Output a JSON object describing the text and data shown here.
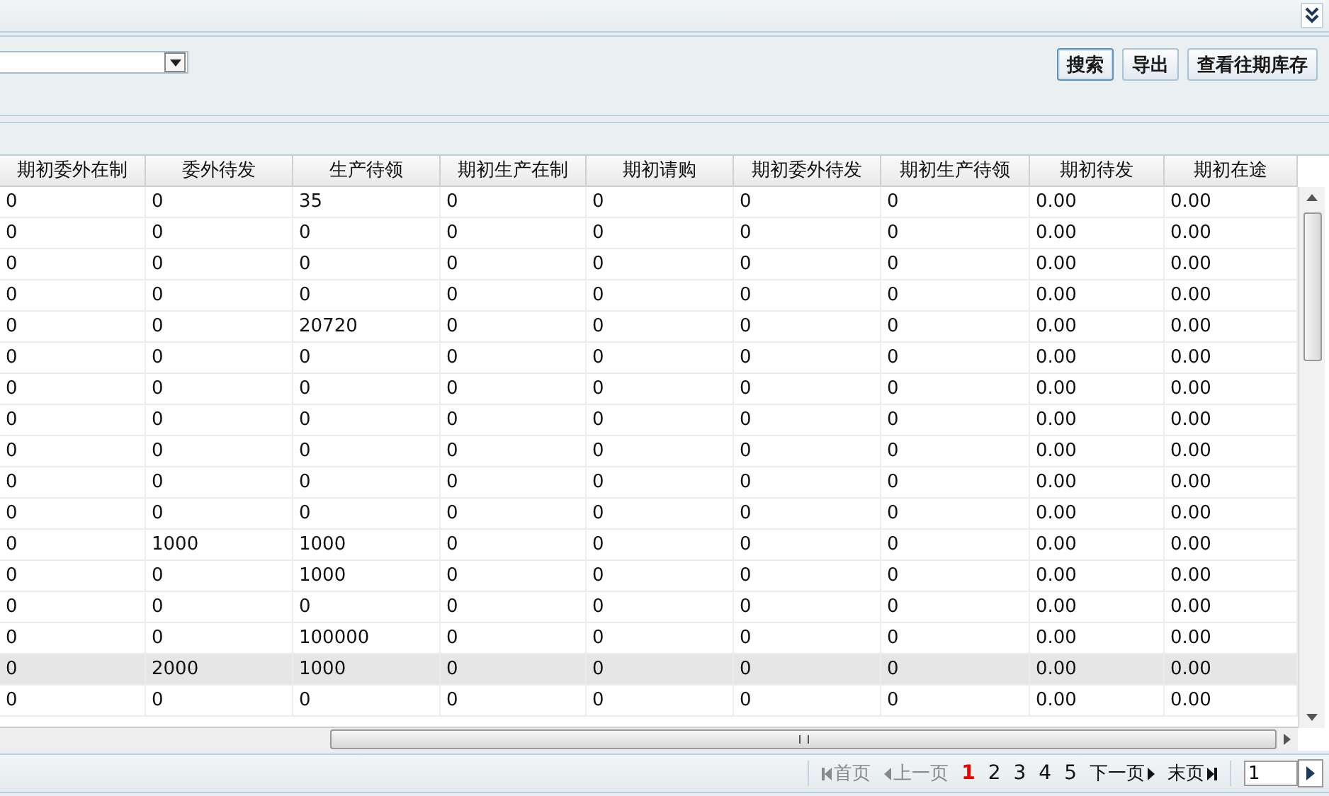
{
  "filter": {
    "buttons": [
      {
        "label": "搜索",
        "selected": true
      },
      {
        "label": "导出",
        "selected": false
      },
      {
        "label": "查看往期库存",
        "selected": false
      }
    ]
  },
  "table": {
    "columns": [
      "期初委外在制",
      "委外待发",
      "生产待领",
      "期初生产在制",
      "期初请购",
      "期初委外待发",
      "期初生产待领",
      "期初待发",
      "期初在途"
    ],
    "rows": [
      {
        "selected": false,
        "cells": [
          "0",
          "0",
          "35",
          "0",
          "0",
          "0",
          "0",
          "0.00",
          "0.00"
        ]
      },
      {
        "selected": false,
        "cells": [
          "0",
          "0",
          "0",
          "0",
          "0",
          "0",
          "0",
          "0.00",
          "0.00"
        ]
      },
      {
        "selected": false,
        "cells": [
          "0",
          "0",
          "0",
          "0",
          "0",
          "0",
          "0",
          "0.00",
          "0.00"
        ]
      },
      {
        "selected": false,
        "cells": [
          "0",
          "0",
          "0",
          "0",
          "0",
          "0",
          "0",
          "0.00",
          "0.00"
        ]
      },
      {
        "selected": false,
        "cells": [
          "0",
          "0",
          "20720",
          "0",
          "0",
          "0",
          "0",
          "0.00",
          "0.00"
        ]
      },
      {
        "selected": false,
        "cells": [
          "0",
          "0",
          "0",
          "0",
          "0",
          "0",
          "0",
          "0.00",
          "0.00"
        ]
      },
      {
        "selected": false,
        "cells": [
          "0",
          "0",
          "0",
          "0",
          "0",
          "0",
          "0",
          "0.00",
          "0.00"
        ]
      },
      {
        "selected": false,
        "cells": [
          "0",
          "0",
          "0",
          "0",
          "0",
          "0",
          "0",
          "0.00",
          "0.00"
        ]
      },
      {
        "selected": false,
        "cells": [
          "0",
          "0",
          "0",
          "0",
          "0",
          "0",
          "0",
          "0.00",
          "0.00"
        ]
      },
      {
        "selected": false,
        "cells": [
          "0",
          "0",
          "0",
          "0",
          "0",
          "0",
          "0",
          "0.00",
          "0.00"
        ]
      },
      {
        "selected": false,
        "cells": [
          "0",
          "0",
          "0",
          "0",
          "0",
          "0",
          "0",
          "0.00",
          "0.00"
        ]
      },
      {
        "selected": false,
        "cells": [
          "0",
          "1000",
          "1000",
          "0",
          "0",
          "0",
          "0",
          "0.00",
          "0.00"
        ]
      },
      {
        "selected": false,
        "cells": [
          "0",
          "0",
          "1000",
          "0",
          "0",
          "0",
          "0",
          "0.00",
          "0.00"
        ]
      },
      {
        "selected": false,
        "cells": [
          "0",
          "0",
          "0",
          "0",
          "0",
          "0",
          "0",
          "0.00",
          "0.00"
        ]
      },
      {
        "selected": false,
        "cells": [
          "0",
          "0",
          "100000",
          "0",
          "0",
          "0",
          "0",
          "0.00",
          "0.00"
        ]
      },
      {
        "selected": true,
        "cells": [
          "0",
          "2000",
          "1000",
          "0",
          "0",
          "0",
          "0",
          "0.00",
          "0.00"
        ]
      },
      {
        "selected": false,
        "cells": [
          "0",
          "0",
          "0",
          "0",
          "0",
          "0",
          "0",
          "0.00",
          "0.00"
        ]
      }
    ]
  },
  "pagination": {
    "first": {
      "label": "首页",
      "disabled": true
    },
    "prev": {
      "label": "上一页",
      "disabled": true
    },
    "pages": [
      {
        "label": "1",
        "selected": true
      },
      {
        "label": "2",
        "selected": false
      },
      {
        "label": "3",
        "selected": false
      },
      {
        "label": "4",
        "selected": false
      },
      {
        "label": "5",
        "selected": false
      }
    ],
    "next": {
      "label": "下一页",
      "disabled": false
    },
    "last": {
      "label": "末页",
      "disabled": false
    },
    "page_input": {
      "value": "1"
    }
  }
}
